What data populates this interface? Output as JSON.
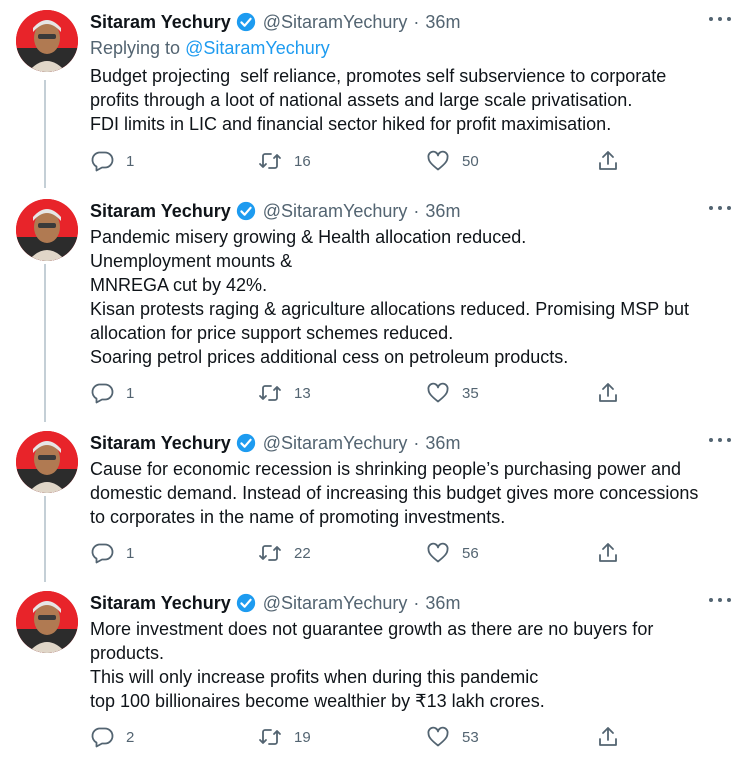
{
  "tweets": [
    {
      "name": "Sitaram Yechury",
      "handle": "@SitaramYechury",
      "separator": "·",
      "time": "36m",
      "replying_prefix": "Replying to ",
      "replying_handle": "@SitaramYechury",
      "lines": [
        "Budget projecting  self reliance, promotes self subservience to corporate",
        "profits through a loot of national assets and large scale privatisation.",
        "FDI limits in LIC and financial sector hiked for profit maximisation."
      ],
      "replies": "1",
      "retweets": "16",
      "likes": "50"
    },
    {
      "name": "Sitaram Yechury",
      "handle": "@SitaramYechury",
      "separator": "·",
      "time": "36m",
      "lines": [
        "Pandemic misery growing & Health allocation reduced.",
        "Unemployment mounts &",
        "MNREGA cut by 42%.",
        "Kisan protests raging & agriculture allocations reduced. Promising MSP but",
        "allocation for price support schemes reduced.",
        "Soaring petrol prices additional cess on petroleum products."
      ],
      "replies": "1",
      "retweets": "13",
      "likes": "35"
    },
    {
      "name": "Sitaram Yechury",
      "handle": "@SitaramYechury",
      "separator": "·",
      "time": "36m",
      "lines": [
        "Cause for economic recession is shrinking people’s purchasing power and",
        "domestic demand. Instead of increasing this budget gives more concessions",
        "to corporates in the name of promoting investments."
      ],
      "replies": "1",
      "retweets": "22",
      "likes": "56"
    },
    {
      "name": "Sitaram Yechury",
      "handle": "@SitaramYechury",
      "separator": "·",
      "time": "36m",
      "lines": [
        "More investment does not guarantee growth as there are no buyers for",
        "products.",
        "This will only increase profits when during this pandemic",
        "top 100 billionaires become wealthier by ₹13 lakh crores."
      ],
      "replies": "2",
      "retweets": "19",
      "likes": "53"
    }
  ],
  "icons": {
    "verified": "verified-badge-icon",
    "more": "more-options-icon",
    "reply": "reply-bubble-icon",
    "retweet": "retweet-icon",
    "like": "heart-icon",
    "share": "share-icon"
  },
  "colors": {
    "accent": "#1d9bf0",
    "text": "#0f1419",
    "muted": "#536471",
    "thread_line": "#c4cfd6",
    "avatar_bg": "#e8242a"
  }
}
